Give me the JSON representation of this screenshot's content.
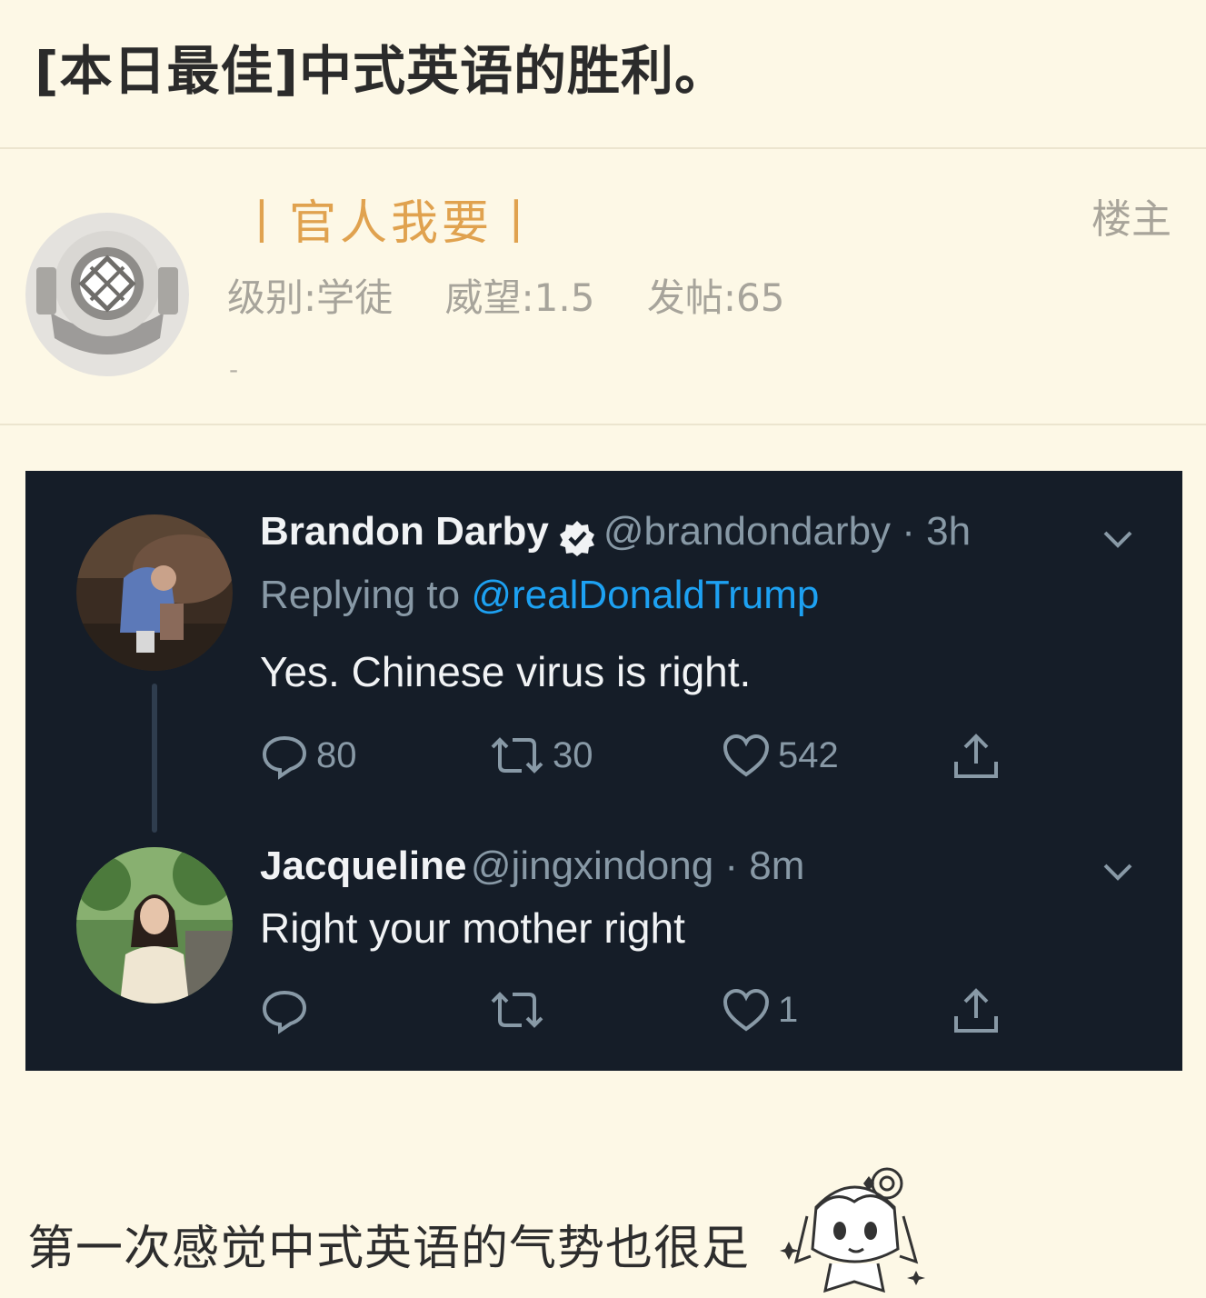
{
  "post": {
    "title": "[本日最佳]中式英语的胜利。"
  },
  "author": {
    "name": "丨官人我要丨",
    "badge": "楼主",
    "level": "级别:学徒",
    "reputation": "威望:1.5",
    "posts": "发帖:65",
    "signature": "-",
    "avatar_icon": "diving-helmet-icon"
  },
  "tweets": [
    {
      "name": "Brandon Darby",
      "handle": "@brandondarby · 3h",
      "verified": true,
      "reply_prefix": "Replying to ",
      "reply_to": "@realDonaldTrump",
      "text": "Yes. Chinese virus is right.",
      "replies": "80",
      "retweets": "30",
      "likes": "542"
    },
    {
      "name": "Jacqueline",
      "handle": "@jingxindong · 8m",
      "text": "Right your mother right",
      "replies": "",
      "retweets": "",
      "likes": "1"
    }
  ],
  "comment": {
    "text": "第一次感觉中式英语的气势也很足"
  },
  "colors": {
    "page_bg": "#fdf8e6",
    "username": "#e0a24f",
    "tweet_bg": "#151d28",
    "tweet_link": "#1da1f2",
    "muted": "#8899a6"
  }
}
